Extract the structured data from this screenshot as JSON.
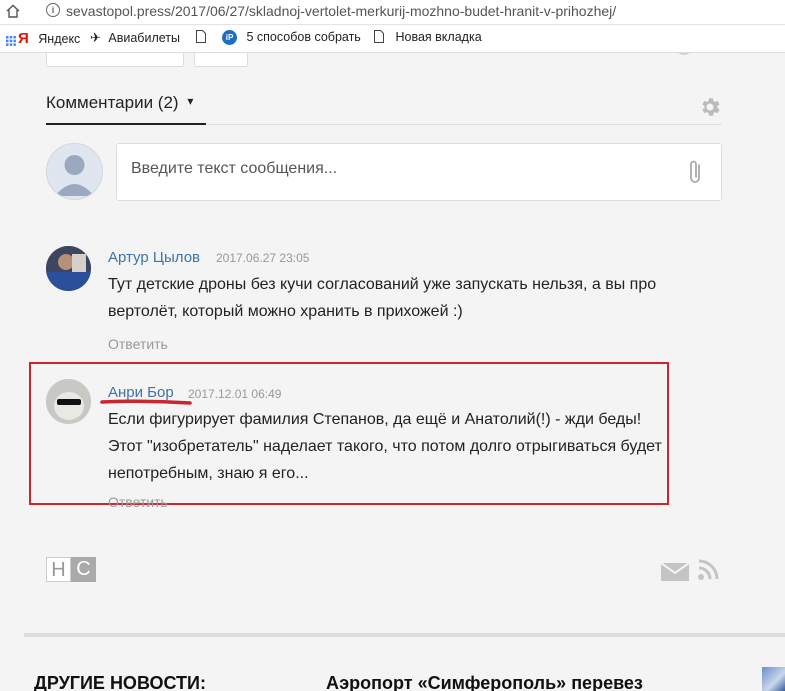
{
  "browser": {
    "url": "sevastopol.press/2017/06/27/skladnoj-vertolet-merkurij-mozhno-budet-hranit-v-prihozhej/",
    "bookmarks": [
      {
        "label": "Яндекс",
        "icon": "yandex-icon"
      },
      {
        "label": "Авиабилеты",
        "icon": "plane-icon"
      },
      {
        "label": "",
        "icon": "page-icon"
      },
      {
        "label": "5 способов собрать",
        "icon": "ip-icon"
      },
      {
        "label": "Новая вкладка",
        "icon": "page-icon"
      }
    ]
  },
  "comments_section": {
    "tab_label": "Комментарии (2)",
    "tab_arrow": "▾",
    "input_placeholder": "Введите текст сообщения...",
    "comments": [
      {
        "author": "Артур Цылов",
        "date": "2017.06.27 23:05",
        "text": "Тут детские дроны без кучи согласований уже запускать нельзя, а вы про вертолёт, который можно хранить в прихожей :)",
        "reply": "Ответить"
      },
      {
        "author": "Анри Бор",
        "date": "2017.12.01 06:49",
        "text": "Если фигурирует фамилия Степанов, да ещё и Анатолий(!) - жди беды! Этот \"изобретатель\" наделает такого, что потом долго отрыгиваться будет непотребным, знаю я его...",
        "reply": "Ответить"
      }
    ]
  },
  "footer": {
    "logo_letters": [
      "Н",
      "С"
    ],
    "other_news_label": "ДРУГИЕ НОВОСТИ:",
    "news_headline": "Аэропорт «Симферополь» перевез"
  },
  "colors": {
    "accent_link": "#3d73a8",
    "highlight_red": "#c9262f"
  }
}
